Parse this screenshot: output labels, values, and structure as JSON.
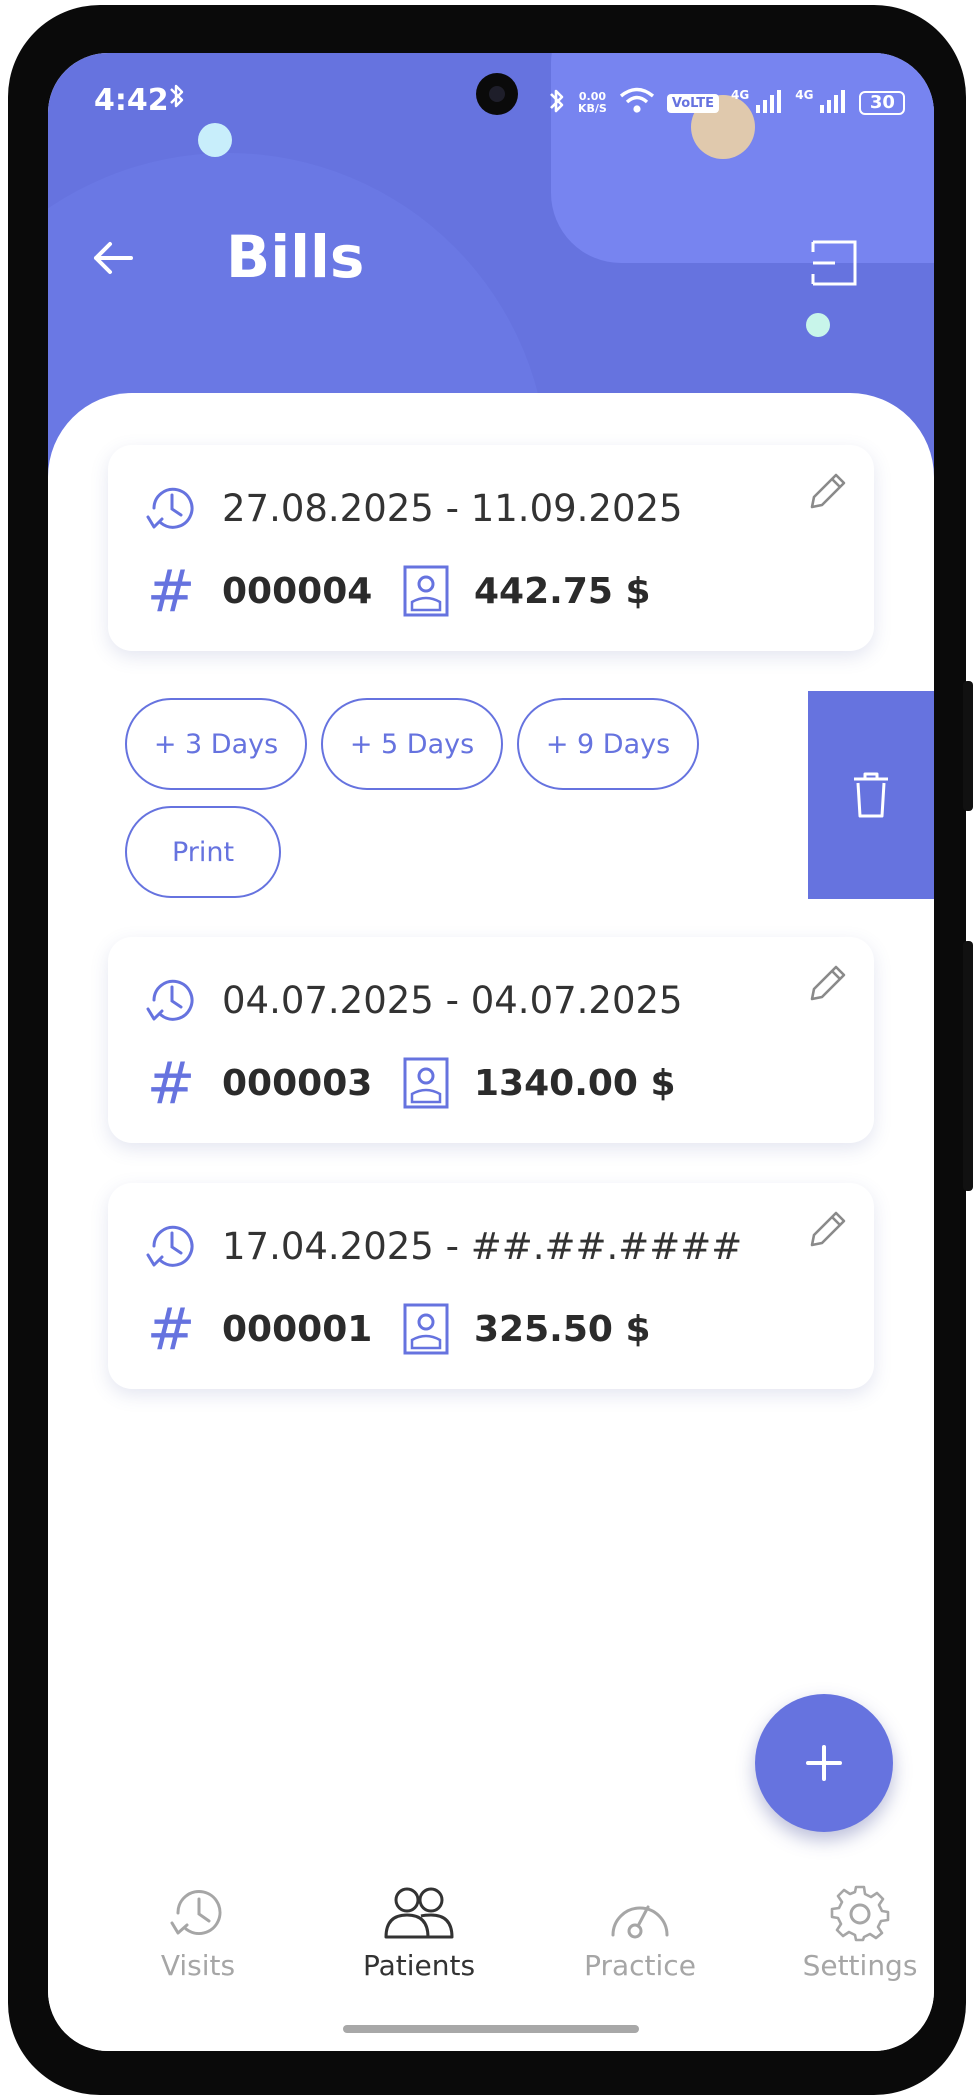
{
  "status_bar": {
    "time": "4:42",
    "data_speed_value": "0.00",
    "data_speed_unit": "KB/S",
    "volte": "VoLTE",
    "network_1": "4G",
    "network_2": "4G",
    "battery": "30",
    "battery_level": 0.3
  },
  "header": {
    "title": "Bills"
  },
  "bills": [
    {
      "date_range": "27.08.2025 - 11.09.2025",
      "number": "000004",
      "amount": "442.75 $"
    },
    {
      "date_range": "04.07.2025 - 04.07.2025",
      "number": "000003",
      "amount": "1340.00 $"
    },
    {
      "date_range": "17.04.2025 - ##.##.####",
      "number": "000001",
      "amount": "325.50 $"
    }
  ],
  "bill_actions": {
    "extend_3": "+ 3 Days",
    "extend_5": "+ 5 Days",
    "extend_9": "+ 9 Days",
    "print": "Print"
  },
  "bottom_nav": [
    {
      "label": "Visits",
      "icon": "clock-icon",
      "active": false
    },
    {
      "label": "Patients",
      "icon": "people-icon",
      "active": true
    },
    {
      "label": "Practice",
      "icon": "gauge-icon",
      "active": false
    },
    {
      "label": "Settings",
      "icon": "gear-icon",
      "active": false
    }
  ],
  "colors": {
    "accent": "#6673df",
    "header_light": "#7784f0",
    "dot_mint": "#c8f5ea",
    "dot_sand": "#e0c9ad",
    "text_dark": "#2b2b2b",
    "text_muted": "#a6a6a6"
  }
}
